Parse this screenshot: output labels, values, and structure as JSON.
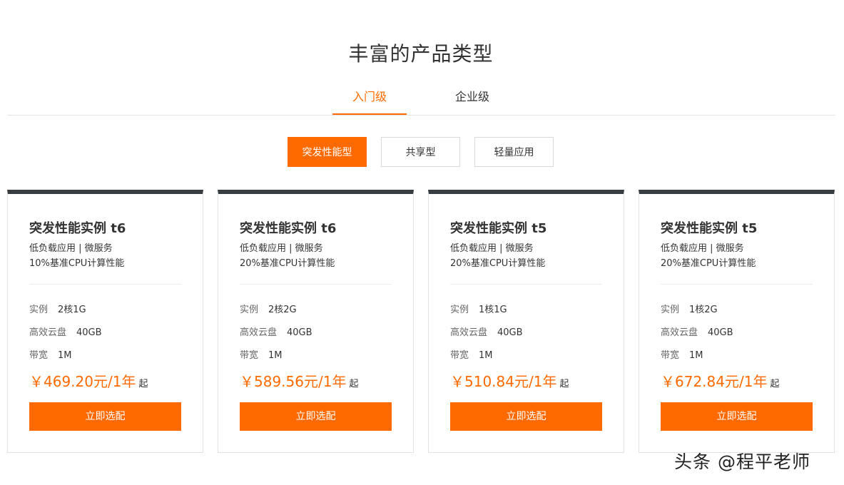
{
  "section": {
    "title": "丰富的产品类型"
  },
  "tabs": [
    {
      "label": "入门级",
      "active": true
    },
    {
      "label": "企业级",
      "active": false
    }
  ],
  "subtabs": [
    {
      "label": "突发性能型",
      "active": true
    },
    {
      "label": "共享型",
      "active": false
    },
    {
      "label": "轻量应用",
      "active": false
    }
  ],
  "spec_labels": {
    "instance": "实例",
    "disk": "高效云盘",
    "bandwidth": "带宽"
  },
  "cards": [
    {
      "title": "突发性能实例 t6",
      "desc1": "低负载应用 | 微服务",
      "desc2": "10%基准CPU计算性能",
      "instance": "2核1G",
      "disk": "40GB",
      "bandwidth": "1M",
      "price": "￥469.20元/1年",
      "price_suffix": "起",
      "button": "立即选配"
    },
    {
      "title": "突发性能实例 t6",
      "desc1": "低负载应用 | 微服务",
      "desc2": "20%基准CPU计算性能",
      "instance": "2核2G",
      "disk": "40GB",
      "bandwidth": "1M",
      "price": "￥589.56元/1年",
      "price_suffix": "起",
      "button": "立即选配"
    },
    {
      "title": "突发性能实例 t5",
      "desc1": "低负载应用 | 微服务",
      "desc2": "20%基准CPU计算性能",
      "instance": "1核1G",
      "disk": "40GB",
      "bandwidth": "1M",
      "price": "￥510.84元/1年",
      "price_suffix": "起",
      "button": "立即选配"
    },
    {
      "title": "突发性能实例 t5",
      "desc1": "低负载应用 | 微服务",
      "desc2": "20%基准CPU计算性能",
      "instance": "1核2G",
      "disk": "40GB",
      "bandwidth": "1M",
      "price": "￥672.84元/1年",
      "price_suffix": "起",
      "button": "立即选配"
    }
  ],
  "watermark": "头条 @程平老师",
  "colors": {
    "accent": "#ff6a00",
    "card_top_border": "#373d41",
    "text": "#333333"
  }
}
